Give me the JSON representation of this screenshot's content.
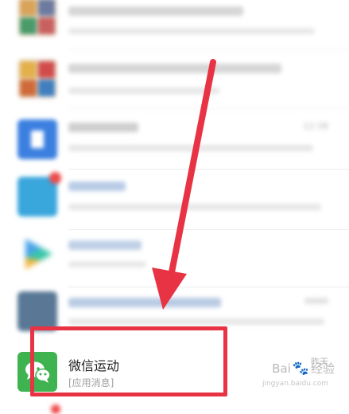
{
  "chat_list": {
    "rows": [
      {
        "title": "",
        "subtitle": "",
        "time": ""
      },
      {
        "title": "",
        "subtitle": "",
        "time": ""
      },
      {
        "title": "",
        "subtitle": "",
        "time": "12:38"
      },
      {
        "title": "",
        "subtitle": "",
        "time": ""
      },
      {
        "title": "",
        "subtitle": "",
        "time": ""
      },
      {
        "title": "",
        "subtitle": "",
        "time": ""
      },
      {
        "title": "微信运动",
        "subtitle": "[应用消息]",
        "time": "昨天"
      }
    ]
  },
  "colors": {
    "highlight": "#e83344",
    "wechat_sport": "#3fb34f",
    "subscription": "#3b7fe0",
    "unread_badge": "#f04a4a"
  },
  "watermark": {
    "brand_left": "Bai",
    "brand_right": "经验",
    "url": "jingyan.baidu.com"
  },
  "icons": {
    "wechat_sport": "wechat-sport-icon",
    "subscription": "subscription-account-icon",
    "video": "video-play-icon"
  }
}
